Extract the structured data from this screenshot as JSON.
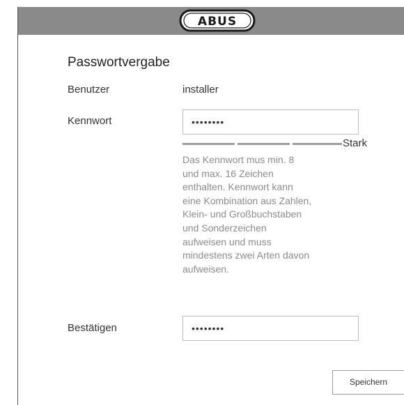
{
  "header": {
    "logo_text": "ABUS",
    "background_color": "#8a8a8a"
  },
  "page_title": "Passwortvergabe",
  "user_row": {
    "label": "Benutzer",
    "value": "installer"
  },
  "password_row": {
    "label": "Kennwort",
    "masked_value": "••••••••",
    "strength_label": "Stark",
    "hint_lines": [
      "Das Kennwort mus min. 8",
      "und max. 16 Zeichen",
      "enthalten. Kennwort kann",
      "eine Kombination aus Zahlen,",
      "Klein- und Großbuchstaben",
      "und Sonderzeichen",
      "aufweisen und muss",
      "mindestens zwei Arten davon",
      "aufweisen."
    ]
  },
  "confirm_row": {
    "label": "Bestätigen",
    "masked_value": "••••••••"
  },
  "save_button": {
    "label": "Speichern"
  }
}
